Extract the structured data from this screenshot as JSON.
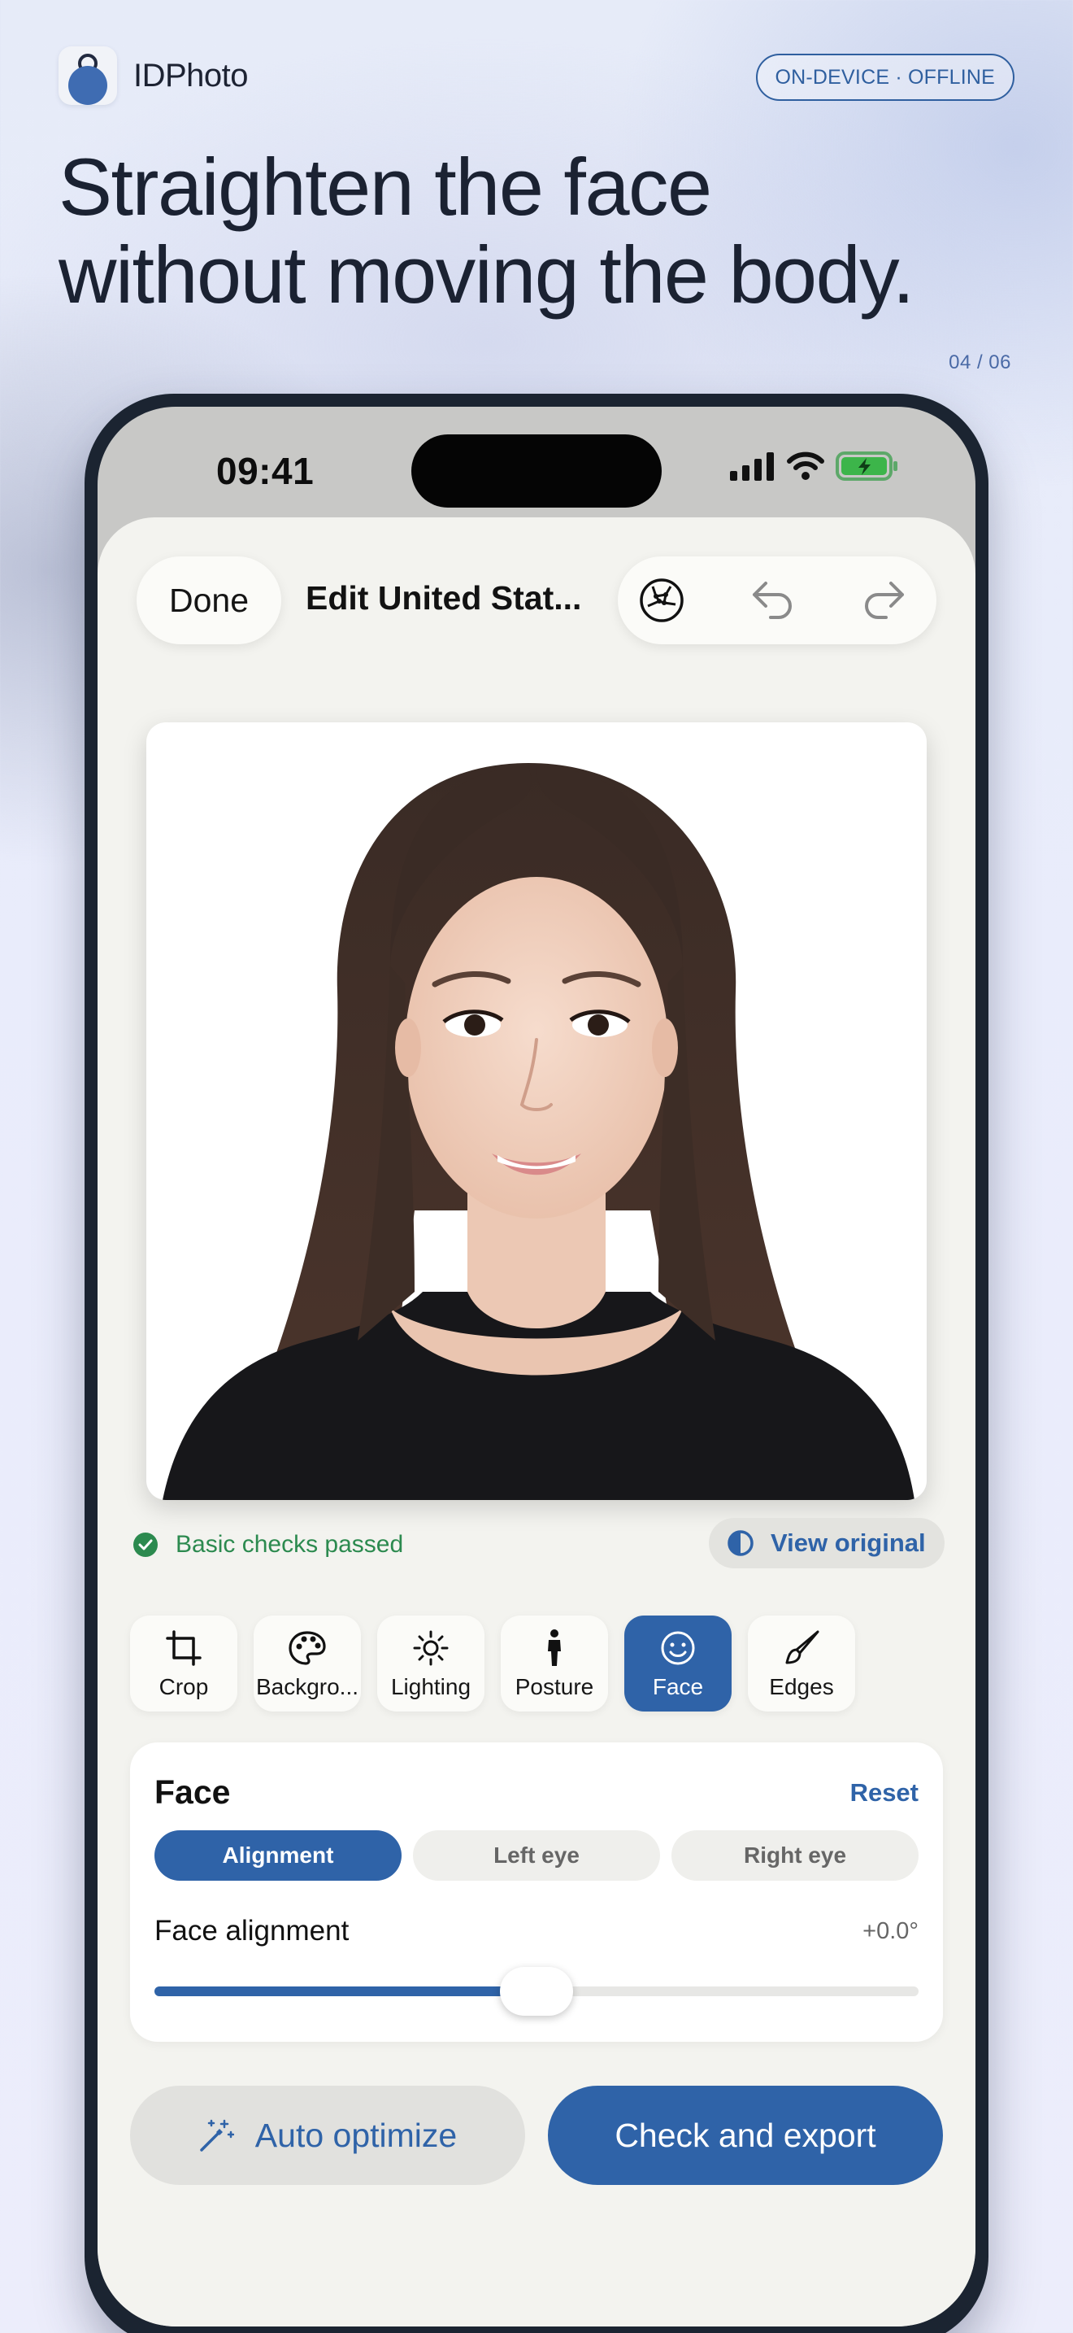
{
  "app": {
    "name": "IDPhoto",
    "badge": "ON-DEVICE · OFFLINE",
    "logo_icon": "person-lock-icon"
  },
  "hero": {
    "headline_line1": "Straighten the face",
    "headline_line2": "without moving the body.",
    "pager": "04 / 06"
  },
  "status_bar": {
    "time": "09:41",
    "icons": [
      "signal-icon",
      "wifi-icon",
      "battery-charging-icon"
    ]
  },
  "editor": {
    "done_label": "Done",
    "title": "Edit United Stat...",
    "toolbar_icons": [
      "face-grid-icon",
      "undo-icon",
      "redo-icon"
    ],
    "checks_text": "Basic checks passed",
    "view_original_label": "View original",
    "tools": [
      {
        "label": "Crop",
        "icon": "crop-icon"
      },
      {
        "label": "Backgro...",
        "icon": "palette-icon"
      },
      {
        "label": "Lighting",
        "icon": "sun-icon"
      },
      {
        "label": "Posture",
        "icon": "person-icon"
      },
      {
        "label": "Face",
        "icon": "smiley-icon",
        "active": true
      },
      {
        "label": "Edges",
        "icon": "brush-icon"
      }
    ],
    "panel": {
      "title": "Face",
      "reset_label": "Reset",
      "segments": [
        "Alignment",
        "Left eye",
        "Right eye"
      ],
      "active_segment": "Alignment",
      "slider_label": "Face alignment",
      "slider_value": "+0.0°",
      "slider_position": 0.5
    },
    "auto_optimize_label": "Auto optimize",
    "export_label": "Check and export"
  },
  "colors": {
    "accent": "#2f63a8",
    "success": "#2c8a4f",
    "ink": "#1b2232"
  }
}
